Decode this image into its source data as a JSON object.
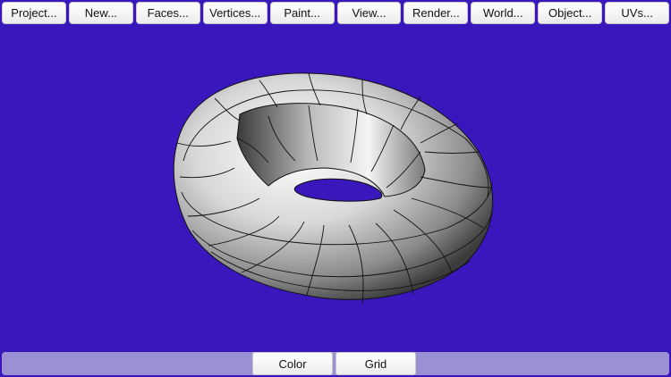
{
  "menu": {
    "items": [
      {
        "label": "Project..."
      },
      {
        "label": "New..."
      },
      {
        "label": "Faces..."
      },
      {
        "label": "Vertices..."
      },
      {
        "label": "Paint..."
      },
      {
        "label": "View..."
      },
      {
        "label": "Render..."
      },
      {
        "label": "World..."
      },
      {
        "label": "Object..."
      },
      {
        "label": "UVs..."
      }
    ]
  },
  "bottom": {
    "color_label": "Color",
    "grid_label": "Grid"
  },
  "colors": {
    "background": "#3a17bd",
    "bottom_bar": "#9b90d4"
  },
  "viewport": {
    "object": "torus-mesh"
  }
}
